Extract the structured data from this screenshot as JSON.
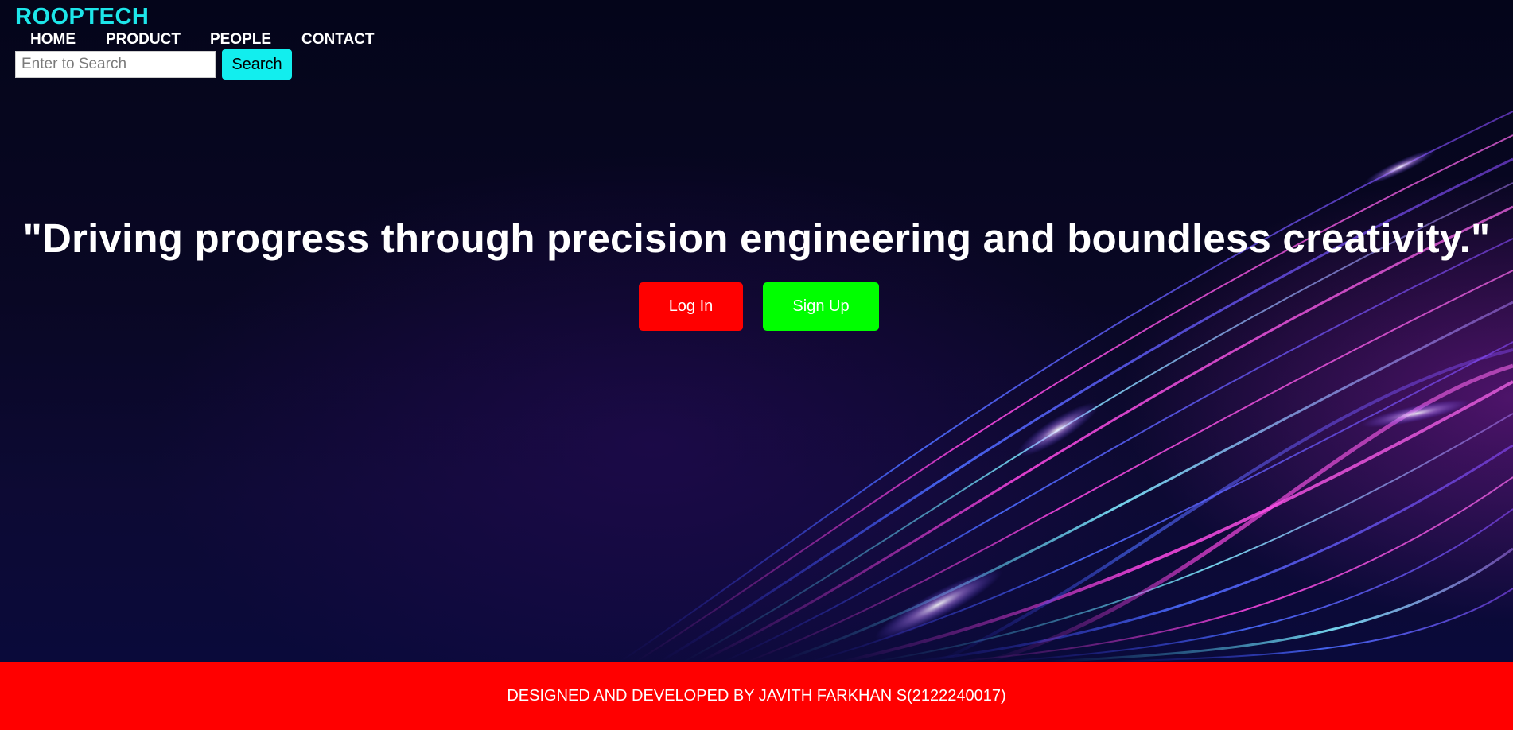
{
  "brand": {
    "name": "ROOPTECH"
  },
  "nav": {
    "items": [
      {
        "label": "HOME"
      },
      {
        "label": "PRODUCT"
      },
      {
        "label": "PEOPLE"
      },
      {
        "label": "CONTACT"
      }
    ]
  },
  "search": {
    "placeholder": "Enter to Search",
    "value": "",
    "button_label": "Search"
  },
  "hero": {
    "headline": "\"Driving progress through precision engineering and boundless creativity.\"",
    "login_label": "Log In",
    "signup_label": "Sign Up"
  },
  "footer": {
    "credit": "DESIGNED AND DEVELOPED BY JAVITH FARKHAN S(2122240017)"
  },
  "colors": {
    "brand": "#1de6ea",
    "search_button": "#12eeee",
    "login_button": "#ff0000",
    "signup_button": "#00ff00",
    "footer": "#ff0000",
    "background": "#05041e"
  }
}
